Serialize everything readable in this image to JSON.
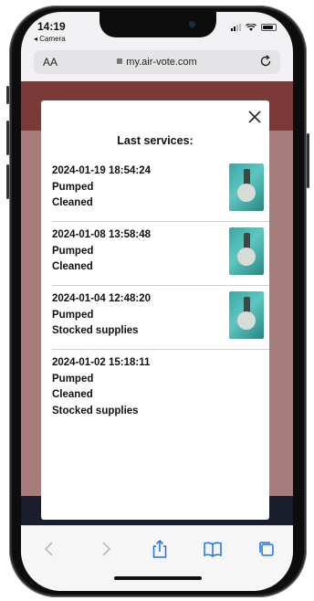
{
  "status_bar": {
    "time": "14:19",
    "back_app": "◂ Camera"
  },
  "browser": {
    "text_size_label": "AA",
    "url": "my.air-vote.com"
  },
  "modal": {
    "title": "Last services:",
    "services": [
      {
        "timestamp": "2024-01-19 18:54:24",
        "actions": [
          "Pumped",
          "Cleaned"
        ],
        "has_photo": true
      },
      {
        "timestamp": "2024-01-08 13:58:48",
        "actions": [
          "Pumped",
          "Cleaned"
        ],
        "has_photo": true
      },
      {
        "timestamp": "2024-01-04 12:48:20",
        "actions": [
          "Pumped",
          "Stocked supplies"
        ],
        "has_photo": true
      },
      {
        "timestamp": "2024-01-02 15:18:11",
        "actions": [
          "Pumped",
          "Cleaned",
          "Stocked supplies"
        ],
        "has_photo": false
      }
    ]
  },
  "toolbar": {
    "icons": [
      "back-icon",
      "forward-icon",
      "share-icon",
      "bookmarks-icon",
      "tabs-icon"
    ]
  },
  "colors": {
    "page_header": "#7b3a38",
    "page_body": "#a67d7a",
    "thumbnail_teal": "#3aa7a3"
  }
}
